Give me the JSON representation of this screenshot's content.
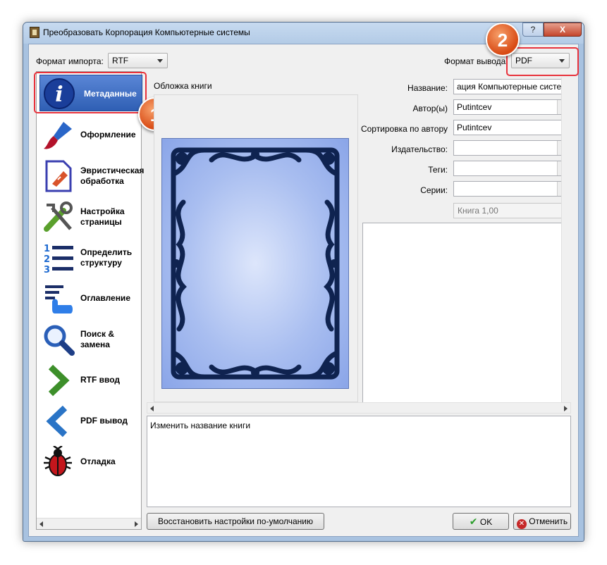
{
  "window": {
    "title": "Преобразовать Корпорация Компьютерные системы",
    "help_label": "?",
    "close_label": "X"
  },
  "import_format": {
    "label": "Формат импорта:",
    "value": "RTF"
  },
  "output_format": {
    "label": "Формат вывода",
    "value": "PDF"
  },
  "sidebar": {
    "items": [
      {
        "label": "Метаданные",
        "icon": "info-icon"
      },
      {
        "label": "Оформление",
        "icon": "brush-icon"
      },
      {
        "label": "Эвристическая обработка",
        "icon": "document-icon"
      },
      {
        "label": "Настройка страницы",
        "icon": "tools-icon"
      },
      {
        "label": "Определить структуру",
        "icon": "numbered-list-icon"
      },
      {
        "label": "Оглавление",
        "icon": "toc-icon"
      },
      {
        "label": "Поиск & замена",
        "icon": "search-icon"
      },
      {
        "label": "RTF ввод",
        "icon": "arrow-right-icon"
      },
      {
        "label": "PDF вывод",
        "icon": "arrow-left-icon"
      },
      {
        "label": "Отладка",
        "icon": "bug-icon"
      }
    ],
    "selected_index": 0
  },
  "callouts": {
    "one": "1",
    "two": "2"
  },
  "cover": {
    "label": "Обложка книги"
  },
  "metadata": {
    "title_label": "Название:",
    "title_value": "ация Компьютерные систем",
    "author_label": "Автор(ы)",
    "author_value": "Putintcev",
    "sort_label": "Сортировка по автору",
    "sort_value": "Putintcev",
    "publisher_label": "Издательство:",
    "publisher_value": "",
    "tags_label": "Теги:",
    "tags_value": "",
    "series_label": "Серии:",
    "series_value": "",
    "series_index": "Книга 1,00"
  },
  "hint_text": "Изменить название книги",
  "buttons": {
    "restore": "Восстановить настройки по-умолчанию",
    "ok": "OK",
    "cancel": "Отменить"
  },
  "colors": {
    "selection": "#2f5fb4",
    "highlight_box": "#e8323c",
    "badge": "#d84a14",
    "ok_check": "#2a9d2a",
    "cancel_x": "#c62828"
  }
}
